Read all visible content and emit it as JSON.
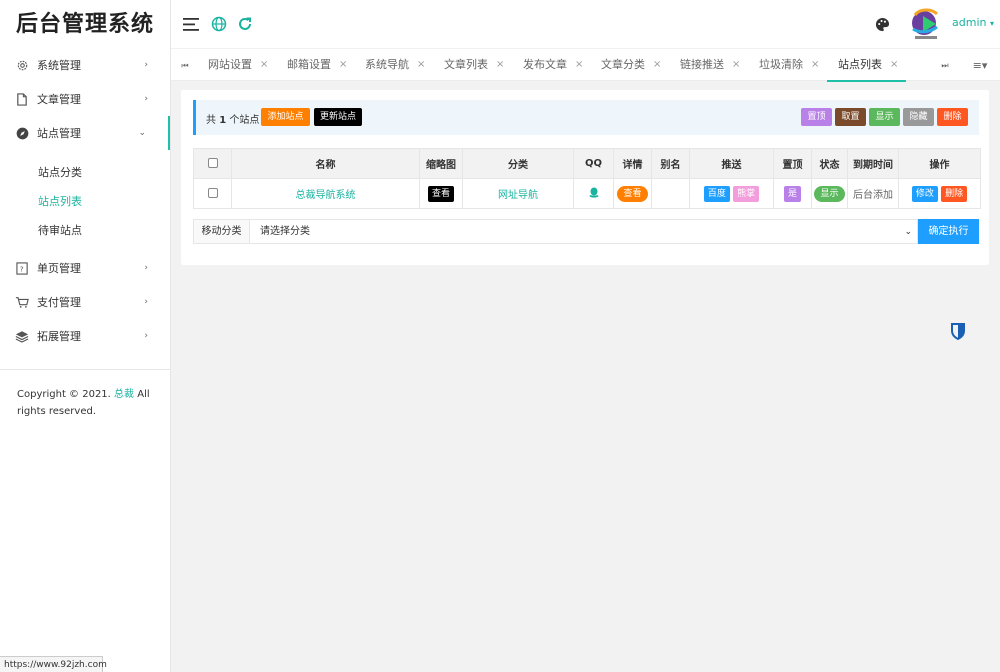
{
  "app": {
    "title": "后台管理系统",
    "user": "admin",
    "status_url": "https://www.92jzh.com"
  },
  "sidebar": {
    "items": [
      {
        "label": "系统管理",
        "icon": "gear-icon"
      },
      {
        "label": "文章管理",
        "icon": "document-icon"
      },
      {
        "label": "站点管理",
        "icon": "compass-icon",
        "open": true,
        "children": [
          {
            "label": "站点分类"
          },
          {
            "label": "站点列表",
            "active": true
          },
          {
            "label": "待审站点"
          }
        ]
      },
      {
        "label": "单页管理",
        "icon": "page-icon"
      },
      {
        "label": "支付管理",
        "icon": "cart-icon"
      },
      {
        "label": "拓展管理",
        "icon": "layers-icon"
      }
    ],
    "copyright_prefix": "Copyright © 2021.",
    "copyright_link": "总裁",
    "copyright_suffix": "All rights reserved."
  },
  "tabs": [
    "网站设置",
    "邮箱设置",
    "系统导航",
    "文章列表",
    "发布文章",
    "文章分类",
    "链接推送",
    "垃圾清除",
    "站点列表"
  ],
  "toolbar": {
    "count_prefix": "共",
    "count": "1",
    "count_suffix": "个站点",
    "add_label": "添加站点",
    "update_label": "更新站点",
    "top_label": "置顶",
    "untop_label": "取置",
    "show_label": "显示",
    "hide_label": "隐藏",
    "delete_label": "删除"
  },
  "table": {
    "headers": [
      "名称",
      "缩略图",
      "分类",
      "QQ",
      "详情",
      "别名",
      "推送",
      "置顶",
      "状态",
      "到期时间",
      "操作"
    ],
    "rows": [
      {
        "name": "总裁导航系统",
        "thumb_label": "查看",
        "category": "网址导航",
        "detail_label": "查看",
        "alias": "",
        "push_baidu": "百度",
        "push_other": "熊掌",
        "top": "是",
        "status": "显示",
        "expire": "后台添加",
        "edit_label": "修改",
        "delete_label": "删除"
      }
    ]
  },
  "move": {
    "label": "移动分类",
    "select_value": "请选择分类",
    "confirm_label": "确定执行"
  },
  "colors": {
    "accent": "#19b3a0",
    "blue": "#1e9fff",
    "orange": "#ff7f00",
    "purple": "#b980e8",
    "brown": "#7a4a2a",
    "green": "#5cb85c",
    "gray": "#999999",
    "red": "#ff5722",
    "pink": "#f39ddc"
  }
}
